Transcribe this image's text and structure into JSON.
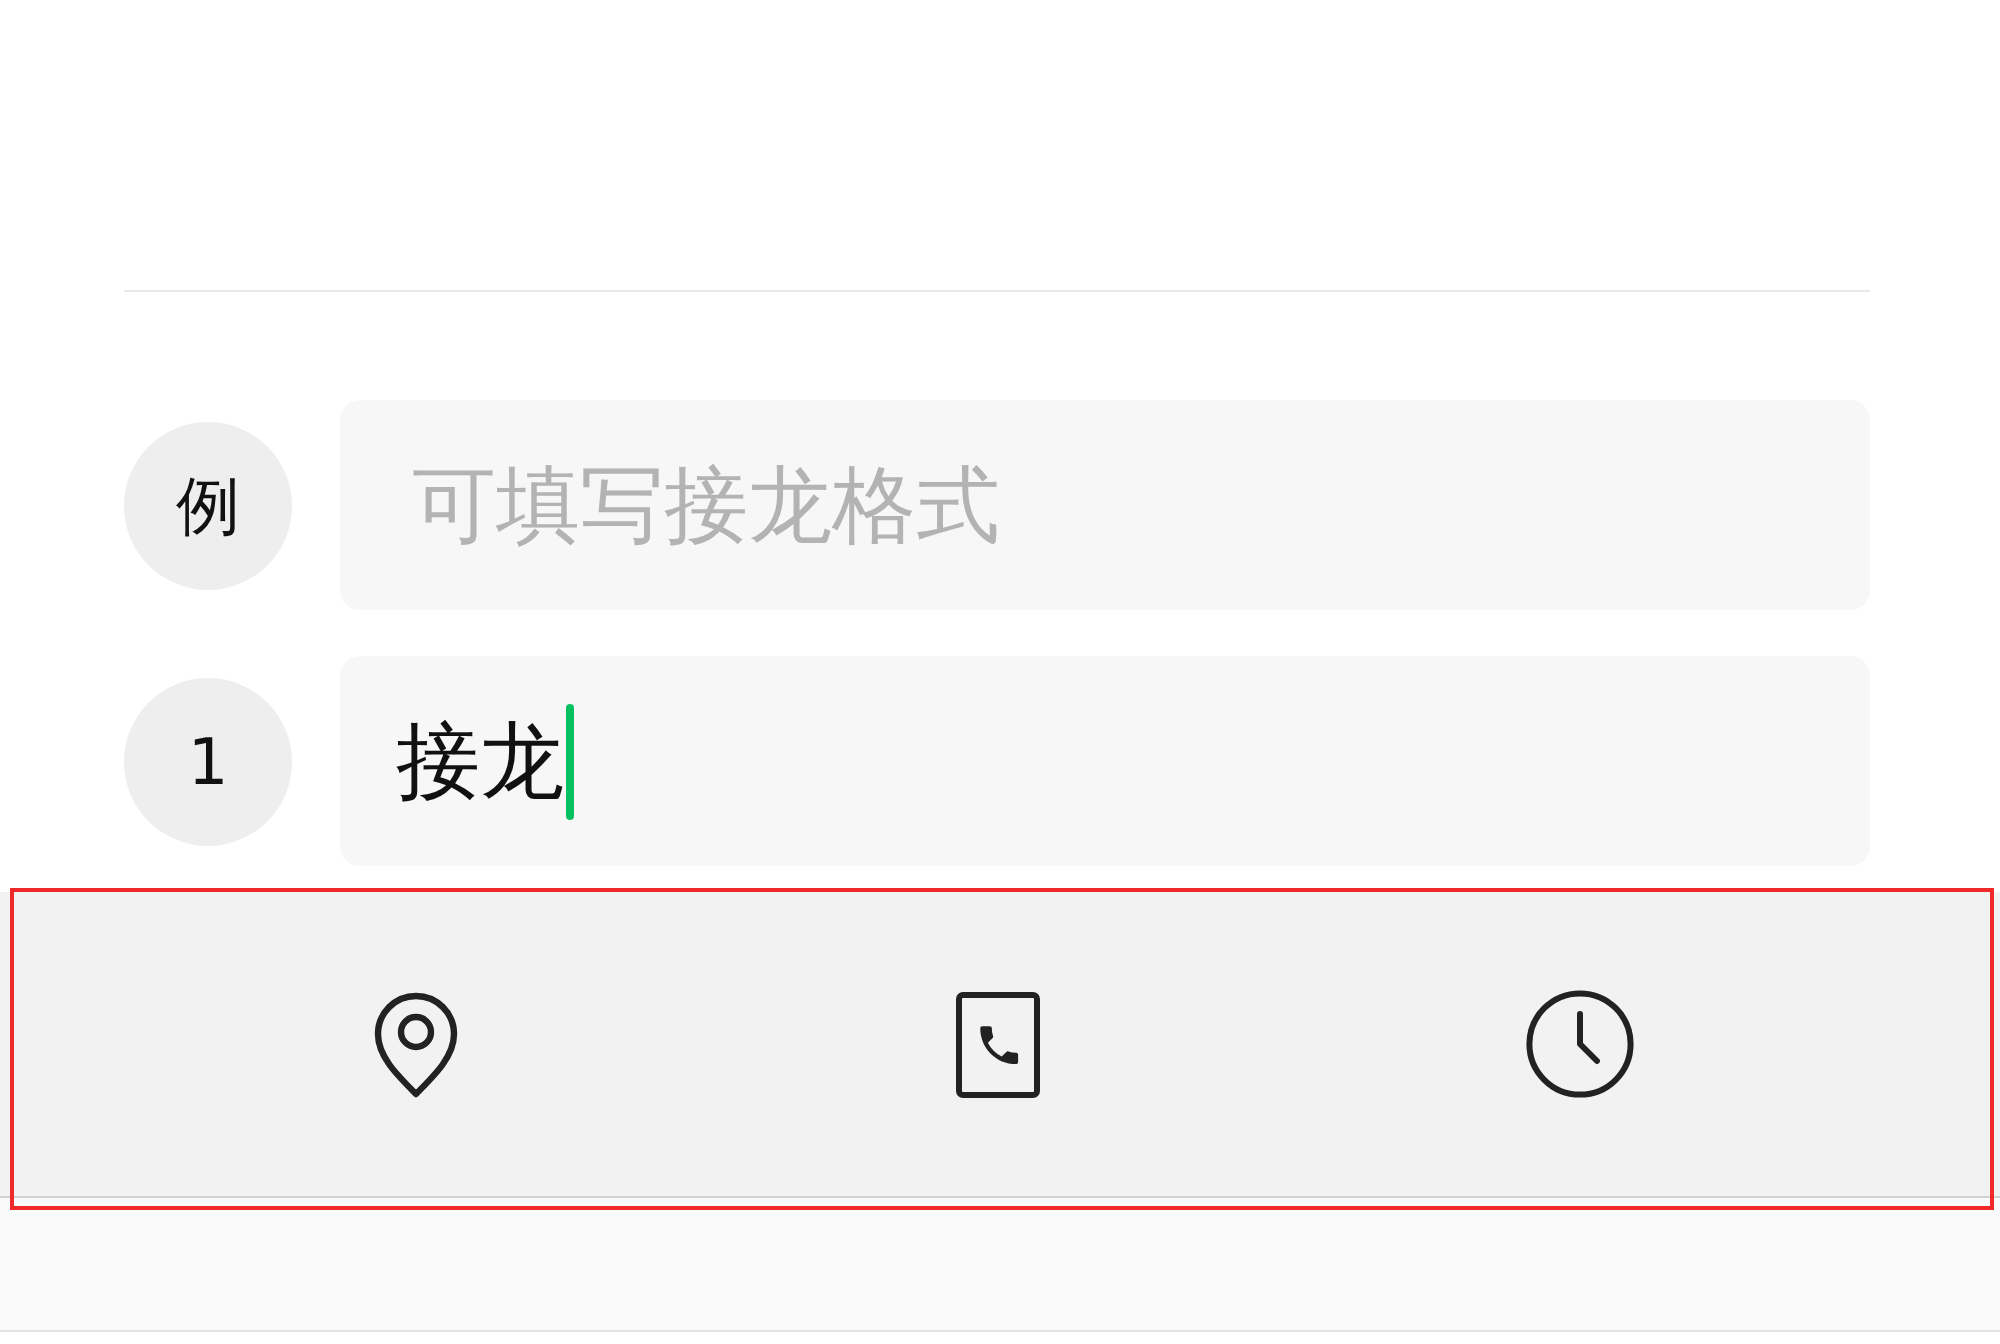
{
  "entries": [
    {
      "badge": "例",
      "placeholder": "可填写接龙格式",
      "focused": false
    },
    {
      "badge": "1",
      "value": "接龙",
      "focused": true
    }
  ],
  "toolbar": {
    "highlighted": true,
    "tools": [
      {
        "kind": "location"
      },
      {
        "kind": "contact"
      },
      {
        "kind": "clock"
      }
    ]
  }
}
